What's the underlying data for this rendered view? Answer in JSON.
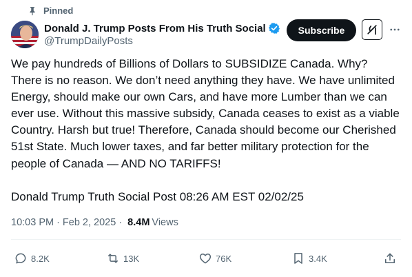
{
  "pinned": {
    "label": "Pinned"
  },
  "author": {
    "display_name": "Donald J. Trump Posts From His Truth Social",
    "handle": "@TrumpDailyPosts",
    "verified": true
  },
  "header_actions": {
    "subscribe_label": "Subscribe",
    "grok_icon": "grok-icon",
    "more_icon": "more-options-icon"
  },
  "post": {
    "text": "We pay hundreds of Billions of Dollars to SUBSIDIZE Canada. Why? There is no reason. We don’t need anything they have. We have unlimited Energy, should make our own Cars, and have more Lumber than we can ever use. Without this massive subsidy, Canada ceases to exist as a viable Country. Harsh but true! Therefore, Canada should become our Cherished 51st State. Much lower taxes, and far better military protection for the people of Canada — AND NO TARIFFS!",
    "source_line": "Donald Trump Truth Social Post 08:26 AM EST 02/02/25"
  },
  "meta": {
    "time": "10:03 PM",
    "separator": "·",
    "date": "Feb 2, 2025",
    "separator2": "·",
    "views_count": "8.4M",
    "views_label": "Views"
  },
  "actions": {
    "replies": "8.2K",
    "reposts": "13K",
    "likes": "76K",
    "bookmarks": "3.4K"
  },
  "colors": {
    "primary_text": "#0f1419",
    "secondary_text": "#536471",
    "verified_blue": "#1d9bf0",
    "subscribe_bg": "#0f1419"
  }
}
